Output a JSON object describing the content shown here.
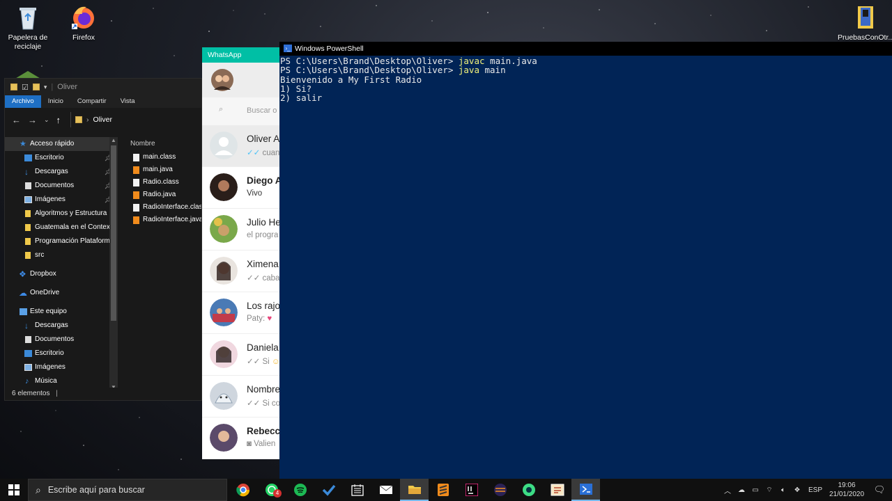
{
  "desktop": {
    "icons": [
      {
        "label": "Papelera de reciclaje"
      },
      {
        "label": "Firefox"
      },
      {
        "label": "PruebasConOtr..."
      }
    ]
  },
  "explorer": {
    "title": "Oliver",
    "ribbon_tabs": [
      "Archivo",
      "Inicio",
      "Compartir",
      "Vista"
    ],
    "address": "Oliver",
    "column_header": "Nombre",
    "nav_items": [
      {
        "label": "Acceso rápido"
      },
      {
        "label": "Escritorio"
      },
      {
        "label": "Descargas"
      },
      {
        "label": "Documentos"
      },
      {
        "label": "Imágenes"
      },
      {
        "label": "Algoritmos y Estructura"
      },
      {
        "label": "Guatemala en el Contex"
      },
      {
        "label": "Programación Plataform"
      },
      {
        "label": "src"
      },
      {
        "label": "Dropbox"
      },
      {
        "label": "OneDrive"
      },
      {
        "label": "Este equipo"
      },
      {
        "label": "Descargas"
      },
      {
        "label": "Documentos"
      },
      {
        "label": "Escritorio"
      },
      {
        "label": "Imágenes"
      },
      {
        "label": "Música"
      }
    ],
    "files": [
      {
        "name": "main.class"
      },
      {
        "name": "main.java"
      },
      {
        "name": "Radio.class"
      },
      {
        "name": "Radio.java"
      },
      {
        "name": "RadioInterface.class"
      },
      {
        "name": "RadioInterface.java"
      }
    ],
    "status": "6 elementos"
  },
  "whatsapp": {
    "title": "WhatsApp",
    "search_placeholder": "Buscar o",
    "chats": [
      {
        "name": "Oliver A",
        "preview": "cuand"
      },
      {
        "name": "Diego A",
        "preview": "Vivo"
      },
      {
        "name": "Julio He",
        "preview": "el progra"
      },
      {
        "name": "Ximena",
        "preview": "cabal"
      },
      {
        "name": "Los rajo",
        "preview": "Paty: "
      },
      {
        "name": "Daniela",
        "preview": "Si "
      },
      {
        "name": "Nombre",
        "preview": "Si con"
      },
      {
        "name": "Rebecc",
        "preview": "Valien"
      }
    ]
  },
  "powershell": {
    "title": "Windows PowerShell",
    "prompt1": "PS C:\\Users\\Brand\\Desktop\\Oliver> ",
    "cmd1": "javac",
    "args1": " main.java",
    "prompt2": "PS C:\\Users\\Brand\\Desktop\\Oliver> ",
    "cmd2": "java",
    "args2": " main",
    "out1": "Bienvenido a My First Radio",
    "out2": "1) Si?",
    "out3": "2) salir"
  },
  "taskbar": {
    "search_placeholder": "Escribe aquí para buscar",
    "whatsapp_badge": "4",
    "language": "ESP",
    "time": "19:06",
    "date": "21/01/2020"
  },
  "colors": {
    "powershell_bg": "#012456",
    "whatsapp_green": "#00bfa5",
    "explorer_accent": "#1e6fc4",
    "taskbar_bg": "#101010"
  }
}
